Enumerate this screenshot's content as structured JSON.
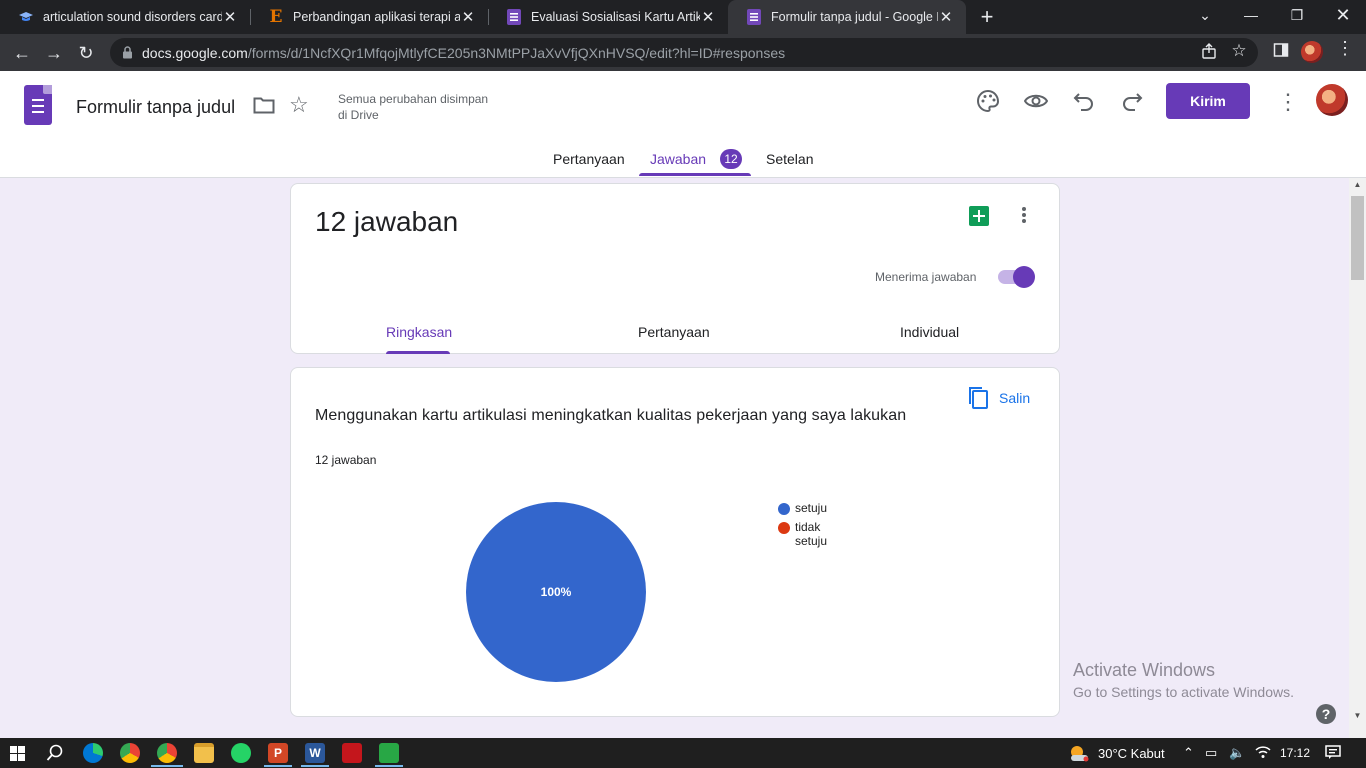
{
  "browser": {
    "tabs": [
      {
        "title": "articulation sound disorders card",
        "icon": "graduation-cap-icon"
      },
      {
        "title": "Perbandingan aplikasi terapi artik",
        "icon": "e-letter-icon"
      },
      {
        "title": "Evaluasi Sosialisasi Kartu Artikula",
        "icon": "google-forms-icon"
      },
      {
        "title": "Formulir tanpa judul - Google Fo",
        "icon": "google-forms-icon"
      }
    ],
    "url_host": "docs.google.com",
    "url_path": "/forms/d/1NcfXQr1MfqojMtlyfCE205n3NMtPPJaXvVfjQXnHVSQ/edit?hl=ID#responses"
  },
  "header": {
    "form_title": "Formulir tanpa judul",
    "save_status_line1": "Semua perubahan disimpan",
    "save_status_line2": "di Drive",
    "send_label": "Kirim",
    "tabs": {
      "questions": "Pertanyaan",
      "responses": "Jawaban",
      "responses_badge": "12",
      "settings": "Setelan"
    }
  },
  "summary_card": {
    "count_title": "12 jawaban",
    "accepting_label": "Menerima jawaban",
    "accepting": true,
    "subtabs": {
      "summary": "Ringkasan",
      "question": "Pertanyaan",
      "individual": "Individual"
    }
  },
  "question_card": {
    "title": "Menggunakan kartu artikulasi meningkatkan kualitas pekerjaan yang saya lakukan",
    "response_count": "12 jawaban",
    "copy_label": "Salin"
  },
  "chart_data": {
    "type": "pie",
    "categories": [
      "setuju",
      "tidak setuju"
    ],
    "values": [
      100,
      0
    ],
    "data_labels": [
      "100%",
      ""
    ],
    "colors": [
      "#3366cc",
      "#dc3912"
    ],
    "legend_position": "right"
  },
  "watermark": {
    "line1": "Activate Windows",
    "line2": "Go to Settings to activate Windows."
  },
  "taskbar": {
    "weather": "30°C  Kabut",
    "time": "17:12"
  }
}
